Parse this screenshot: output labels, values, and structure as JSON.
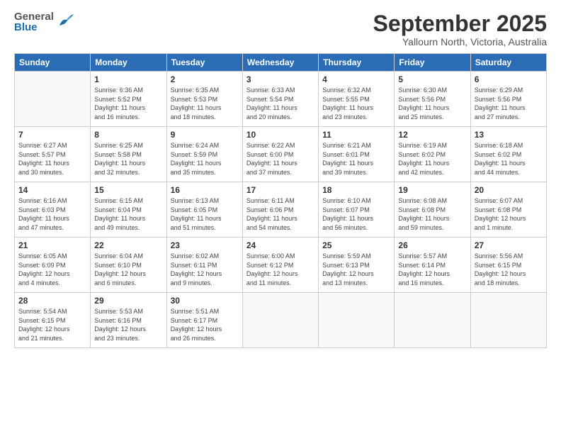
{
  "header": {
    "logo": {
      "general": "General",
      "blue": "Blue"
    },
    "title": "September 2025",
    "subtitle": "Yallourn North, Victoria, Australia"
  },
  "weekdays": [
    "Sunday",
    "Monday",
    "Tuesday",
    "Wednesday",
    "Thursday",
    "Friday",
    "Saturday"
  ],
  "weeks": [
    [
      {
        "day": "",
        "info": ""
      },
      {
        "day": "1",
        "info": "Sunrise: 6:36 AM\nSunset: 5:52 PM\nDaylight: 11 hours\nand 16 minutes."
      },
      {
        "day": "2",
        "info": "Sunrise: 6:35 AM\nSunset: 5:53 PM\nDaylight: 11 hours\nand 18 minutes."
      },
      {
        "day": "3",
        "info": "Sunrise: 6:33 AM\nSunset: 5:54 PM\nDaylight: 11 hours\nand 20 minutes."
      },
      {
        "day": "4",
        "info": "Sunrise: 6:32 AM\nSunset: 5:55 PM\nDaylight: 11 hours\nand 23 minutes."
      },
      {
        "day": "5",
        "info": "Sunrise: 6:30 AM\nSunset: 5:56 PM\nDaylight: 11 hours\nand 25 minutes."
      },
      {
        "day": "6",
        "info": "Sunrise: 6:29 AM\nSunset: 5:56 PM\nDaylight: 11 hours\nand 27 minutes."
      }
    ],
    [
      {
        "day": "7",
        "info": "Sunrise: 6:27 AM\nSunset: 5:57 PM\nDaylight: 11 hours\nand 30 minutes."
      },
      {
        "day": "8",
        "info": "Sunrise: 6:25 AM\nSunset: 5:58 PM\nDaylight: 11 hours\nand 32 minutes."
      },
      {
        "day": "9",
        "info": "Sunrise: 6:24 AM\nSunset: 5:59 PM\nDaylight: 11 hours\nand 35 minutes."
      },
      {
        "day": "10",
        "info": "Sunrise: 6:22 AM\nSunset: 6:00 PM\nDaylight: 11 hours\nand 37 minutes."
      },
      {
        "day": "11",
        "info": "Sunrise: 6:21 AM\nSunset: 6:01 PM\nDaylight: 11 hours\nand 39 minutes."
      },
      {
        "day": "12",
        "info": "Sunrise: 6:19 AM\nSunset: 6:02 PM\nDaylight: 11 hours\nand 42 minutes."
      },
      {
        "day": "13",
        "info": "Sunrise: 6:18 AM\nSunset: 6:02 PM\nDaylight: 11 hours\nand 44 minutes."
      }
    ],
    [
      {
        "day": "14",
        "info": "Sunrise: 6:16 AM\nSunset: 6:03 PM\nDaylight: 11 hours\nand 47 minutes."
      },
      {
        "day": "15",
        "info": "Sunrise: 6:15 AM\nSunset: 6:04 PM\nDaylight: 11 hours\nand 49 minutes."
      },
      {
        "day": "16",
        "info": "Sunrise: 6:13 AM\nSunset: 6:05 PM\nDaylight: 11 hours\nand 51 minutes."
      },
      {
        "day": "17",
        "info": "Sunrise: 6:11 AM\nSunset: 6:06 PM\nDaylight: 11 hours\nand 54 minutes."
      },
      {
        "day": "18",
        "info": "Sunrise: 6:10 AM\nSunset: 6:07 PM\nDaylight: 11 hours\nand 56 minutes."
      },
      {
        "day": "19",
        "info": "Sunrise: 6:08 AM\nSunset: 6:08 PM\nDaylight: 11 hours\nand 59 minutes."
      },
      {
        "day": "20",
        "info": "Sunrise: 6:07 AM\nSunset: 6:08 PM\nDaylight: 12 hours\nand 1 minute."
      }
    ],
    [
      {
        "day": "21",
        "info": "Sunrise: 6:05 AM\nSunset: 6:09 PM\nDaylight: 12 hours\nand 4 minutes."
      },
      {
        "day": "22",
        "info": "Sunrise: 6:04 AM\nSunset: 6:10 PM\nDaylight: 12 hours\nand 6 minutes."
      },
      {
        "day": "23",
        "info": "Sunrise: 6:02 AM\nSunset: 6:11 PM\nDaylight: 12 hours\nand 9 minutes."
      },
      {
        "day": "24",
        "info": "Sunrise: 6:00 AM\nSunset: 6:12 PM\nDaylight: 12 hours\nand 11 minutes."
      },
      {
        "day": "25",
        "info": "Sunrise: 5:59 AM\nSunset: 6:13 PM\nDaylight: 12 hours\nand 13 minutes."
      },
      {
        "day": "26",
        "info": "Sunrise: 5:57 AM\nSunset: 6:14 PM\nDaylight: 12 hours\nand 16 minutes."
      },
      {
        "day": "27",
        "info": "Sunrise: 5:56 AM\nSunset: 6:15 PM\nDaylight: 12 hours\nand 18 minutes."
      }
    ],
    [
      {
        "day": "28",
        "info": "Sunrise: 5:54 AM\nSunset: 6:15 PM\nDaylight: 12 hours\nand 21 minutes."
      },
      {
        "day": "29",
        "info": "Sunrise: 5:53 AM\nSunset: 6:16 PM\nDaylight: 12 hours\nand 23 minutes."
      },
      {
        "day": "30",
        "info": "Sunrise: 5:51 AM\nSunset: 6:17 PM\nDaylight: 12 hours\nand 26 minutes."
      },
      {
        "day": "",
        "info": ""
      },
      {
        "day": "",
        "info": ""
      },
      {
        "day": "",
        "info": ""
      },
      {
        "day": "",
        "info": ""
      }
    ]
  ]
}
